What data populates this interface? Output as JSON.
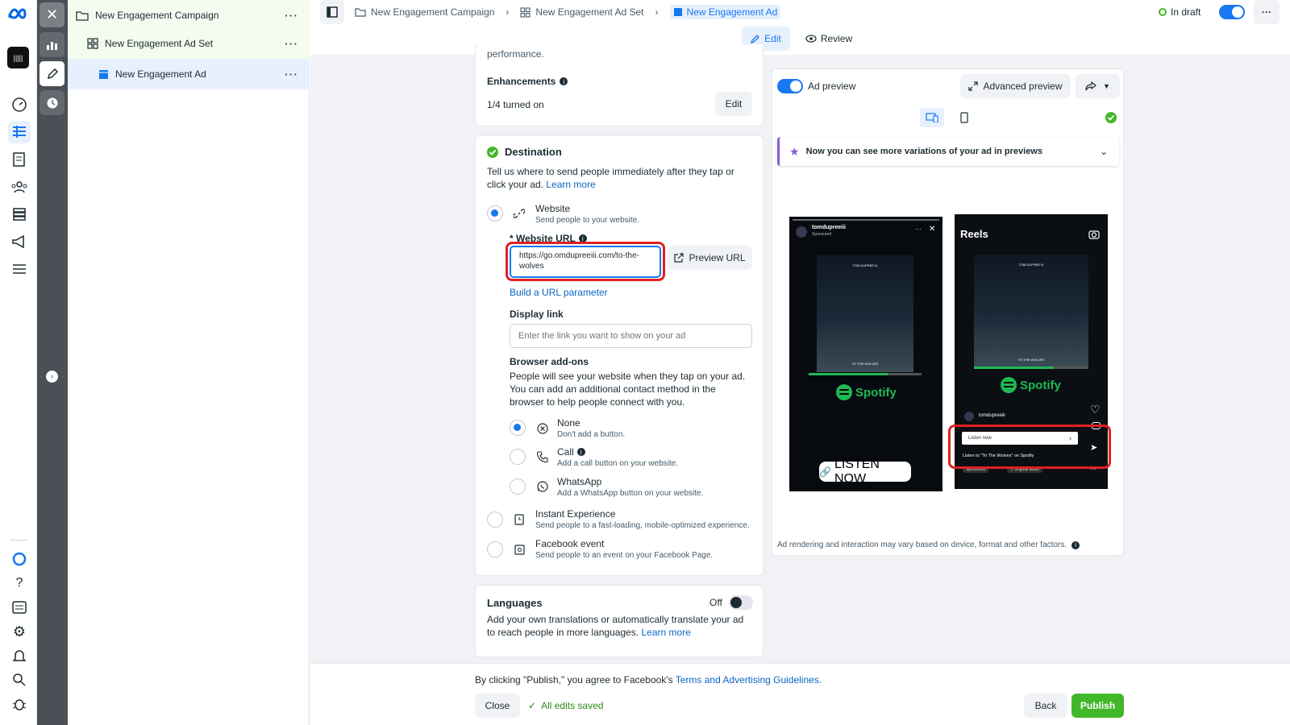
{
  "tree": {
    "campaign": "New Engagement Campaign",
    "adset": "New Engagement Ad Set",
    "ad": "New Engagement Ad",
    "more": "···"
  },
  "breadcrumb": {
    "campaign": "New Engagement Campaign",
    "adset": "New Engagement Ad Set",
    "ad": "New Engagement Ad"
  },
  "topbar": {
    "status": "In draft",
    "more": "···",
    "edit": "Edit",
    "review": "Review"
  },
  "form": {
    "partial_text": "performance.",
    "enhancements": {
      "title": "Enhancements",
      "status": "1/4 turned on",
      "edit": "Edit"
    },
    "destination": {
      "title": "Destination",
      "desc": "Tell us where to send people immediately after they tap or click your ad.",
      "learn_more": "Learn more",
      "website": {
        "title": "Website",
        "desc": "Send people to your website."
      },
      "url_label": "* Website URL",
      "url_value": "https://go.omdupreeiii.com/to-the-wolves",
      "preview_url": "Preview URL",
      "build_param": "Build a URL parameter",
      "display_link_label": "Display link",
      "display_link_placeholder": "Enter the link you want to show on your ad",
      "addons_title": "Browser add-ons",
      "addons_desc": "People will see your website when they tap on your ad. You can add an additional contact method in the browser to help people connect with you.",
      "none": {
        "title": "None",
        "desc": "Don't add a button."
      },
      "call": {
        "title": "Call",
        "desc": "Add a call button on your website."
      },
      "whatsapp": {
        "title": "WhatsApp",
        "desc": "Add a WhatsApp button on your website."
      },
      "instant": {
        "title": "Instant Experience",
        "desc": "Send people to a fast-loading, mobile-optimized experience."
      },
      "event": {
        "title": "Facebook event",
        "desc": "Send people to an event on your Facebook Page."
      }
    },
    "languages": {
      "title": "Languages",
      "toggle_label": "Off",
      "desc": "Add your own translations or automatically translate your ad to reach people in more languages.",
      "learn_more": "Learn more"
    }
  },
  "preview": {
    "label": "Ad preview",
    "advanced": "Advanced preview",
    "banner": "Now you can see more variations of your ad in previews",
    "story": {
      "username": "tomdupreeiii",
      "sponsored": "Sponsored",
      "art_title": "TOM DUPREE III",
      "art_subtitle": "TO THE WOLVES",
      "brand": "Spotify",
      "cta": "LISTEN NOW"
    },
    "reels": {
      "title": "Reels",
      "username": "tomdupreeiii",
      "art_title": "TOM DUPREE III",
      "art_subtitle": "TO THE WOLVES",
      "brand": "Spotify",
      "cta": "Listen now",
      "caption": "Listen to \"To The Wolves\" on Spotify",
      "sponsored": "Sponsored",
      "audio": "Original audio"
    },
    "disclaimer": "Ad rendering and interaction may vary based on device, format and other factors."
  },
  "footer": {
    "terms_prefix": "By clicking \"Publish,\" you agree to Facebook's",
    "terms_link": "Terms and Advertising Guidelines.",
    "close": "Close",
    "saved": "All edits saved",
    "back": "Back",
    "publish": "Publish"
  },
  "colors": {
    "accent": "#1877f2",
    "publish": "#42b72a",
    "highlight": "#e02020"
  }
}
